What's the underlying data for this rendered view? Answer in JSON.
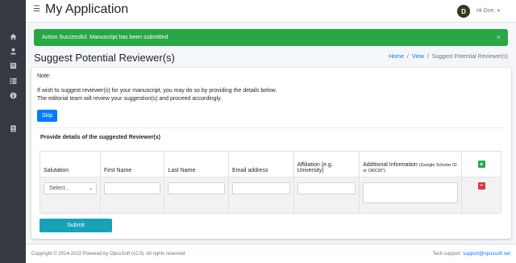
{
  "sidebar": {
    "icons": [
      "home-icon",
      "user-icon",
      "book-icon",
      "list-icon",
      "info-icon",
      "id-card-icon"
    ]
  },
  "header": {
    "menu_icon": "hamburger-icon",
    "title": "My Application",
    "avatar_initial": "D",
    "user_greeting": "Hi Doe,",
    "caret": "▾"
  },
  "alert": {
    "message": "Action Successful. Manuscript has been submitted",
    "close": "×",
    "color": "#28a745"
  },
  "page": {
    "title": "Suggest Potential Reviewer(s)",
    "breadcrumb": [
      "Home",
      "View",
      "Suggest Potential Reviewer(s)"
    ]
  },
  "card": {
    "note_label": "Note:",
    "note_line1": "If wish to suggest reviewer(s) for your manuscript, you may do so by providing the details below.",
    "note_line2": "The editorial team will review your suggestion(s) and proceed accordingly.",
    "skip_label": "Skip",
    "section_title": "Provide details of the suggested Reviewer(s)",
    "table": {
      "headers": {
        "salutation": "Salutation",
        "first_name": "First Name",
        "last_name": "Last Name",
        "email": "Email address",
        "affiliation": "Affiliation (e.g. University)",
        "additional_main": "Additional Information",
        "additional_small": "(Google Scholar ID or ORCID\")"
      },
      "salutation_selected": "Select...",
      "add_symbol": "+",
      "remove_symbol": "−"
    },
    "submit_label": "Submit"
  },
  "footer": {
    "copyright": "Copyright © 2014-2022 Powered by OpusSoft (v2.0). All rights reserved.",
    "support_label": "Tech support:",
    "support_email": "support@opussoft.net"
  },
  "colors": {
    "sidebar_bg": "#343a40",
    "primary": "#007bff",
    "success": "#28a745",
    "danger": "#dc3545",
    "info": "#17a2b8"
  }
}
